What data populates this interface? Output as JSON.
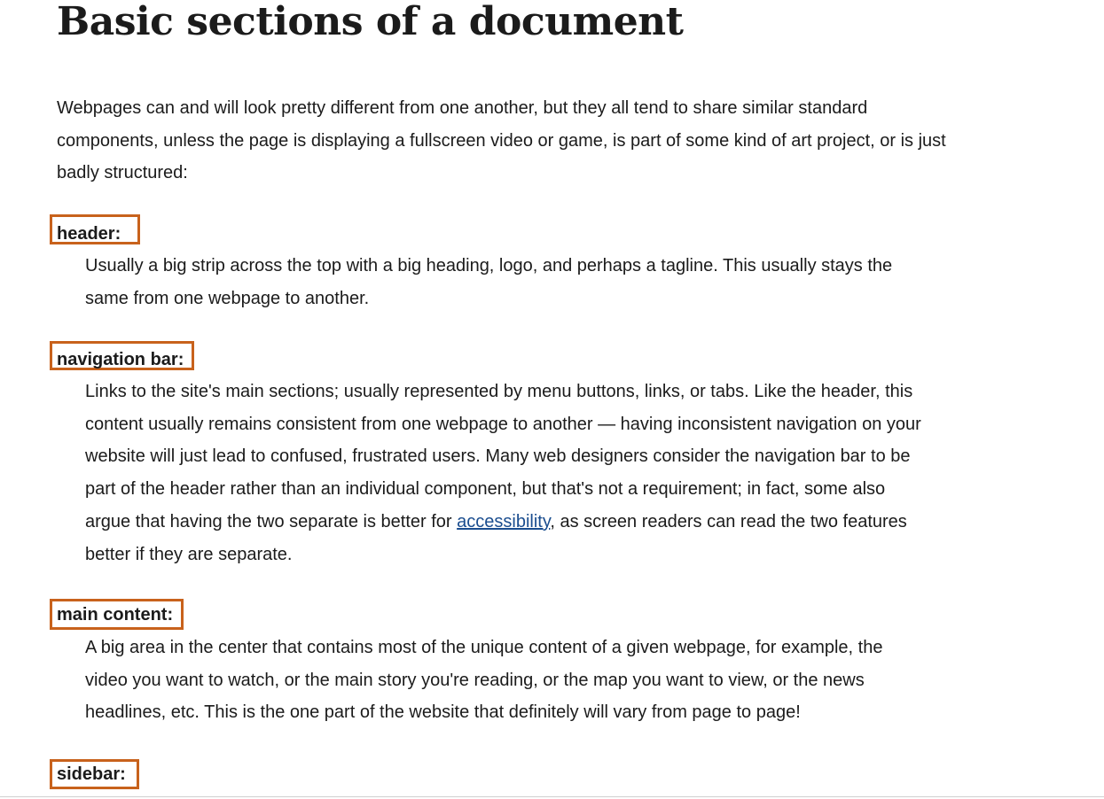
{
  "page_title": "Basic sections of a document",
  "intro": "Webpages can and will look pretty different from one another, but they all tend to share similar standard components, unless the page is displaying a fullscreen video or game, is part of some kind of art project, or is just badly structured:",
  "sections": [
    {
      "term": "header:",
      "description": "Usually a big strip across the top with a big heading, logo, and perhaps a tagline. This usually stays the same from one webpage to another."
    },
    {
      "term": "navigation bar:",
      "description_before_link": "Links to the site's main sections; usually represented by menu buttons, links, or tabs. Like the header, this content usually remains consistent from one webpage to another — having inconsistent navigation on your website will just lead to confused, frustrated users. Many web designers consider the navigation bar to be part of the header rather than an individual component, but that's not a requirement; in fact, some also argue that having the two separate is better for ",
      "link_text": "accessibility",
      "description_after_link": ", as screen readers can read the two features better if they are separate."
    },
    {
      "term": "main content:",
      "description": "A big area in the center that contains most of the unique content of a given webpage, for example, the video you want to watch, or the main story you're reading, or the map you want to view, or the news headlines, etc. This is the one part of the website that definitely will vary from page to page!"
    },
    {
      "term": "sidebar:"
    }
  ],
  "colors": {
    "highlight_border": "#c8621c",
    "link": "#1a4d8f",
    "text": "#1b1b1b"
  }
}
